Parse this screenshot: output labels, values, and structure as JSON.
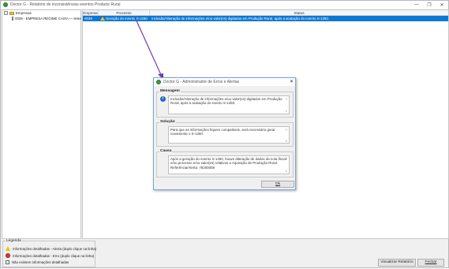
{
  "window": {
    "title": "Doctor G - Relatório de inconsistências eventos Produtor Rural",
    "minimize": "—",
    "maximize": "❐",
    "close": "✕"
  },
  "tree": {
    "root_label": "Empresas",
    "root_expander": "−",
    "child_label": "0039 - EMPRESA REGIME CAIXA — teste"
  },
  "grid": {
    "headers": [
      "Empresa",
      "Processo",
      "Status"
    ],
    "rows": [
      {
        "empresa": "0039",
        "processo": "Geração do evento S-1250",
        "status": "Inclusão/Alteração de informações e/ou valor(es) digitados em Produção Rural, após a acatação do evento S-1250."
      }
    ]
  },
  "dialog": {
    "title": "Doctor G - Administrador de Erros e Alertas",
    "close": "✕",
    "mensagem_label": "Mensagem",
    "mensagem_text": "Inclusão/Alteração de informações e/ou valor(es) digitados em Produção Rural, após a acatação do evento S-1250.",
    "solucao_label": "Solução",
    "solucao_text": "Para que as informações fiquem compatíveis, será necessário gerar novamente o S-1250.",
    "causa_label": "Causa",
    "causa_text": "Após a geração do evento S-1250, houve alteração de dados da nota fiscal e/ou processo e/ou valor(es) relativos a Aquisição de Produção Rural. Referência/Alerta: 79200008",
    "ok_label": "Ok"
  },
  "legend": {
    "title": "Legenda",
    "items": [
      "Informações detalhadas - Alerta (duplo clique na linha)",
      "Informações detalhadas - Erro   (duplo clique na linha)",
      "Não existem informações detalhadas"
    ]
  },
  "buttons": {
    "view_report": "Visualizar Relatório",
    "close": "Fechar"
  },
  "colors": {
    "selection": "#0a78d7",
    "arrow": "#6f3fb0"
  }
}
